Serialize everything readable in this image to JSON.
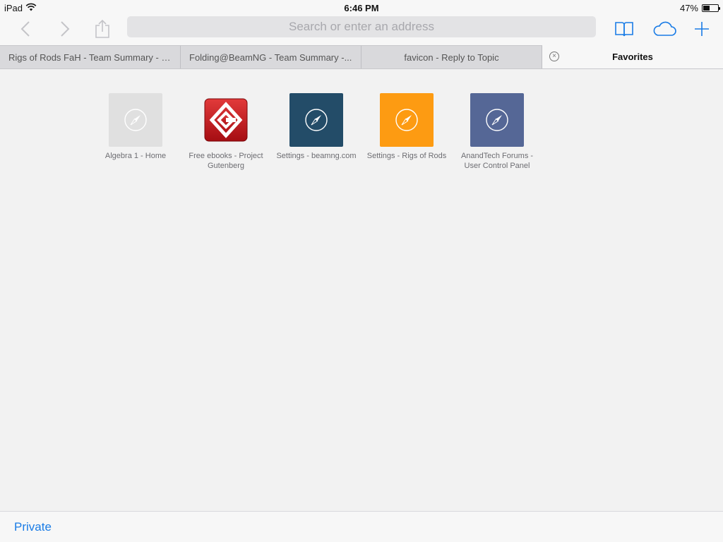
{
  "status": {
    "device": "iPad",
    "wifi_icon": "wifi-icon",
    "time": "6:46 PM",
    "battery_percent": "47%",
    "battery_level": 0.47
  },
  "toolbar": {
    "back_icon": "chevron-left-icon",
    "forward_icon": "chevron-right-icon",
    "share_icon": "share-icon",
    "address_placeholder": "Search or enter an address",
    "bookmarks_icon": "book-icon",
    "icloud_tabs_icon": "cloud-icon",
    "new_tab_icon": "plus-icon",
    "accent_color": "#1a7ce6"
  },
  "tabs": [
    {
      "title": "Rigs of Rods FaH - Team Summary - E...",
      "active": false
    },
    {
      "title": "Folding@BeamNG - Team Summary -...",
      "active": false
    },
    {
      "title": "favicon - Reply to Topic",
      "active": false
    },
    {
      "title": "Favorites",
      "active": true,
      "close_icon": "close-circle-icon"
    }
  ],
  "favorites": [
    {
      "label": "Algebra 1 - Home",
      "color": "#e0e0e0",
      "icon": "compass-icon"
    },
    {
      "label": "Free ebooks - Project Gutenberg",
      "color": "#c0121b",
      "icon": "gutenberg-logo-icon"
    },
    {
      "label": "Settings - beamng.com",
      "color": "#234c68",
      "icon": "compass-icon"
    },
    {
      "label": "Settings - Rigs of Rods",
      "color": "#fd9b12",
      "icon": "compass-icon"
    },
    {
      "label": "AnandTech Forums - User Control Panel",
      "color": "#556796",
      "icon": "compass-icon"
    }
  ],
  "bottom": {
    "private_label": "Private"
  }
}
